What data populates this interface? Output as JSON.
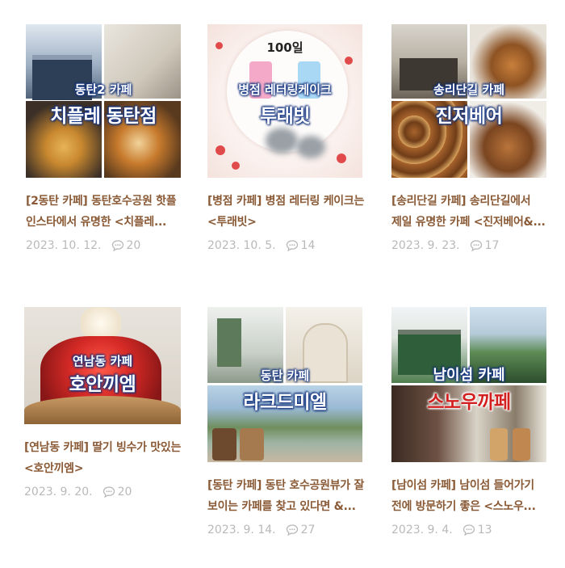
{
  "posts": [
    {
      "thumb_caption_small": "동탄2 카페",
      "thumb_caption_big": "치플레 동탄점",
      "title": "[2동탄 카페] 동탄호수공원 핫플 인스타에서 유명한 <치플레...",
      "date": "2023. 10. 12.",
      "comments": "20"
    },
    {
      "thumb_caption_top": "100일",
      "thumb_caption_small": "병점 레터링케이크",
      "thumb_caption_big": "투래빗",
      "title": "[병점 카페] 병점 레터링 케이크는 <투래빗>",
      "date": "2023. 10. 5.",
      "comments": "14"
    },
    {
      "thumb_caption_small": "송리단길 카페",
      "thumb_caption_big": "진저베어",
      "title": "[송리단길 카페] 송리단길에서 제일 유명한 카페 <진저베어&...",
      "date": "2023. 9. 23.",
      "comments": "17"
    },
    {
      "thumb_caption_small": "연남동 카페",
      "thumb_caption_big": "호안끼엠",
      "title": "[연남동 카페] 딸기 빙수가 맛있는 <호안끼엠>",
      "date": "2023. 9. 20.",
      "comments": "20"
    },
    {
      "thumb_caption_small": "동탄 카페",
      "thumb_caption_big": "라크드미엘",
      "title": "[동탄 카페] 동탄 호수공원뷰가 잘 보이는 카페를 찾고 있다면 &...",
      "date": "2023. 9. 14.",
      "comments": "27"
    },
    {
      "thumb_caption_small": "남이섬 카페",
      "thumb_caption_big": "스노우까페",
      "title": "[남이섬 카페] 남이섬 들어가기 전에 방문하기 좋은 <스노우...",
      "date": "2023. 9. 4.",
      "comments": "13"
    }
  ],
  "icons": {
    "comment": "comment-bubble-icon"
  },
  "colors": {
    "title": "#8a5a36",
    "meta": "#b9b9b9",
    "caption_outline": "#1a3d8f",
    "caption_red": "#d21f1f"
  }
}
